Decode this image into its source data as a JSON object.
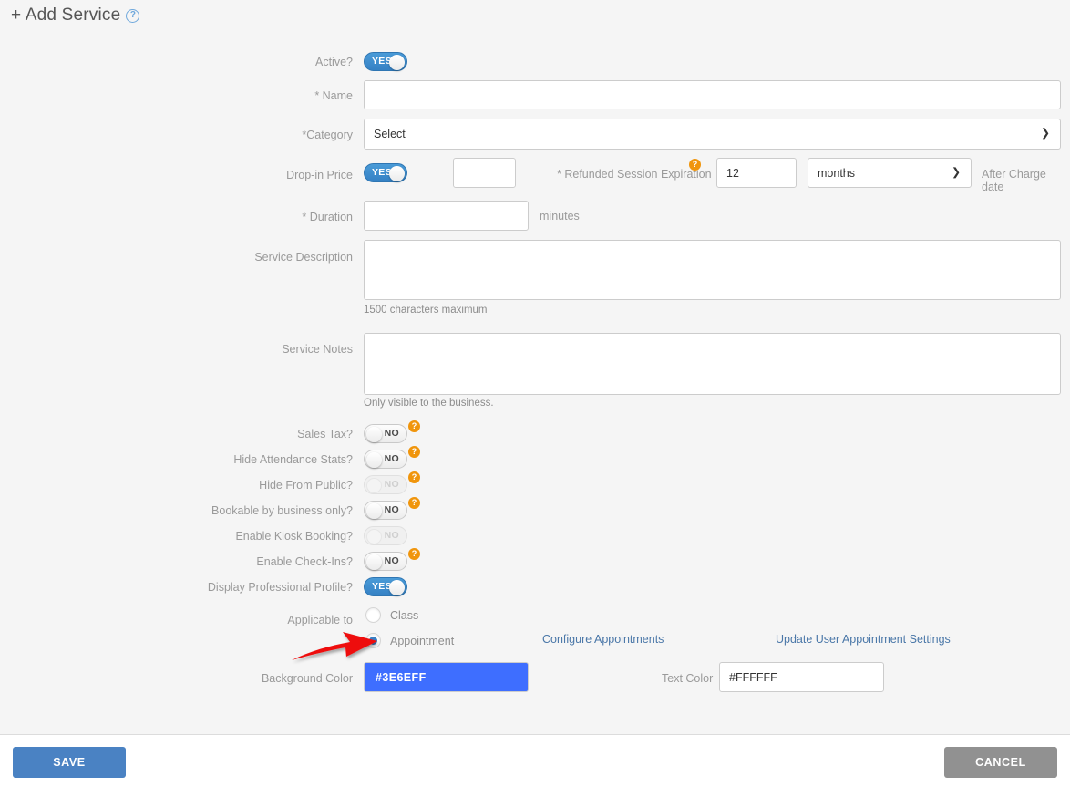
{
  "header": {
    "title": "+ Add Service",
    "help_icon": "help-circle-icon",
    "help_glyph": "?"
  },
  "form": {
    "active": {
      "label": "Active?",
      "value": "YES",
      "state": "on"
    },
    "name": {
      "label": "* Name",
      "value": "",
      "placeholder": ""
    },
    "category": {
      "label": "*Category",
      "selected": "Select",
      "options": [
        "Select"
      ]
    },
    "drop_in_price": {
      "label": "Drop-in Price",
      "toggle_value": "YES",
      "toggle_state": "on",
      "price_value": "",
      "price_placeholder": ""
    },
    "refunded_session_expiration": {
      "label": "* Refunded Session Expiration",
      "help_glyph": "?",
      "amount": "12",
      "unit_selected": "months",
      "unit_options": [
        "months"
      ],
      "suffix": "After Charge date"
    },
    "duration": {
      "label": "* Duration",
      "value": "",
      "unit": "minutes"
    },
    "service_description": {
      "label": "Service Description",
      "value": "",
      "hint": "1500 characters maximum"
    },
    "service_notes": {
      "label": "Service Notes",
      "value": "",
      "hint": "Only visible to the business."
    },
    "toggles": [
      {
        "label": "Sales Tax?",
        "value": "NO",
        "state": "off",
        "disabled": false,
        "help": "?"
      },
      {
        "label": "Hide Attendance Stats?",
        "value": "NO",
        "state": "off",
        "disabled": false,
        "help": "?"
      },
      {
        "label": "Hide From Public?",
        "value": "NO",
        "state": "off",
        "disabled": true,
        "help": "?"
      },
      {
        "label": "Bookable by business only?",
        "value": "NO",
        "state": "off",
        "disabled": false,
        "help": "?"
      },
      {
        "label": "Enable Kiosk Booking?",
        "value": "NO",
        "state": "off",
        "disabled": true,
        "help": ""
      },
      {
        "label": "Enable Check-Ins?",
        "value": "NO",
        "state": "off",
        "disabled": false,
        "help": "?"
      },
      {
        "label": "Display Professional Profile?",
        "value": "YES",
        "state": "on",
        "disabled": false,
        "help": ""
      }
    ],
    "applicable_to": {
      "label": "Applicable to",
      "options": [
        {
          "label": "Class",
          "selected": false
        },
        {
          "label": "Appointment",
          "selected": true
        }
      ]
    },
    "links": {
      "configure_appointments": "Configure Appointments",
      "update_user_appointment_settings": "Update User Appointment Settings"
    },
    "background_color": {
      "label": "Background Color",
      "value": "#3E6EFF"
    },
    "text_color": {
      "label": "Text Color",
      "value": "#FFFFFF"
    }
  },
  "footer": {
    "save_label": "SAVE",
    "cancel_label": "CANCEL"
  },
  "annotation": {
    "arrow_color": "#ee1111",
    "arrow_points_to": "appointment-radio"
  },
  "colors": {
    "page_background": "#F5F5F5",
    "accent_blue": "#3581C4",
    "link_blue": "#4A77A8",
    "help_orange": "#F0950C",
    "swatch_blue": "#3E6EFF",
    "save_blue": "#4A82C3",
    "cancel_gray": "#919191"
  }
}
